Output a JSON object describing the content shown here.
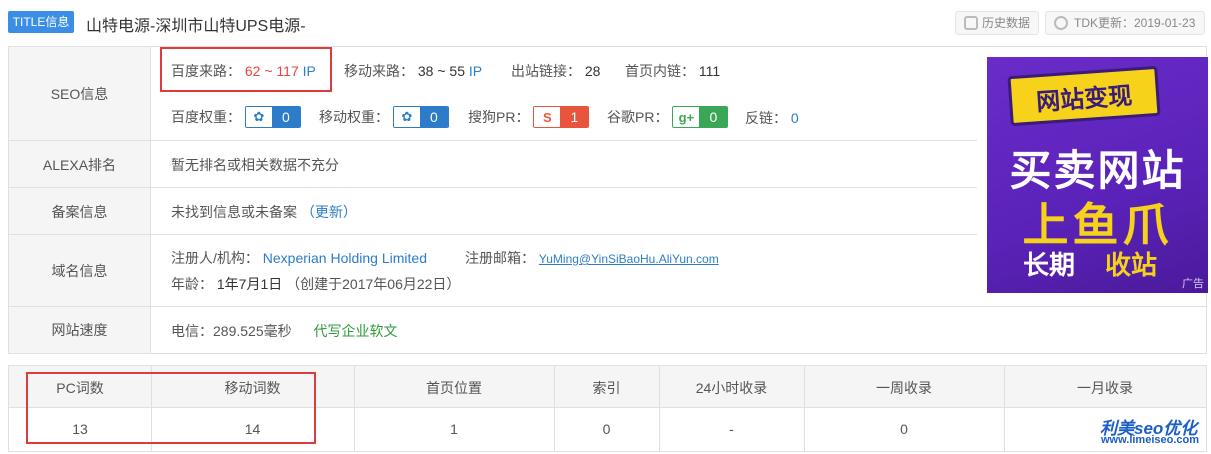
{
  "header": {
    "tag": "TITLE信息",
    "title": "山特电源-深圳市山特UPS电源-",
    "history_btn": "历史数据",
    "tdk_btn": "TDK更新：2019-01-23"
  },
  "seo": {
    "label": "SEO信息",
    "baidu_source_label": "百度来路：",
    "baidu_source_value": "62 ~ 117",
    "baidu_source_unit": "IP",
    "mobile_source_label": "移动来路：",
    "mobile_source_value": "38 ~ 55",
    "mobile_source_unit": "IP",
    "outlinks_label": "出站链接：",
    "outlinks_value": "28",
    "homelinks_label": "首页内链：",
    "homelinks_value": "111",
    "baidu_weight_label": "百度权重：",
    "baidu_weight_value": "0",
    "mobile_weight_label": "移动权重：",
    "mobile_weight_value": "0",
    "sogou_pr_label": "搜狗PR：",
    "sogou_pr_value": "1",
    "google_pr_label": "谷歌PR：",
    "google_pr_value": "0",
    "backlinks_label": "反链：",
    "backlinks_value": "0"
  },
  "alexa": {
    "label": "ALEXA排名",
    "value": "暂无排名或相关数据不充分"
  },
  "icp": {
    "label": "备案信息",
    "value": "未找到信息或未备案",
    "update_link": "（更新）"
  },
  "domain": {
    "label": "域名信息",
    "registrant_label": "注册人/机构：",
    "registrant_value": "Nexperian Holding Limited",
    "email_label": "注册邮箱：",
    "email_value": "YuMing@YinSiBaoHu.AliYun.com",
    "age_label": "年龄：",
    "age_value": "1年7月1日",
    "created": "（创建于2017年06月22日）"
  },
  "speed": {
    "label": "网站速度",
    "value": "电信：289.525毫秒",
    "link": "代写企业软文"
  },
  "ad": {
    "tag": "网站变现",
    "line2": "买卖网站",
    "line3": "上鱼爪",
    "line4a": "长期",
    "line4b": "收站",
    "small": "广告"
  },
  "rank": {
    "headers": [
      "PC词数",
      "移动词数",
      "首页位置",
      "索引",
      "24小时收录",
      "一周收录",
      "一月收录"
    ],
    "values": [
      "13",
      "14",
      "1",
      "0",
      "-",
      "0",
      ""
    ]
  },
  "watermark": {
    "main": "利美seo优化",
    "sub": "www.limeiseo.com"
  },
  "colors": {
    "accent": "#3a8ee6",
    "link": "#2d7cc9",
    "highlight_border": "#e23a3a",
    "ad_bg": "#5a22b8",
    "ad_yellow": "#f6d21a"
  }
}
